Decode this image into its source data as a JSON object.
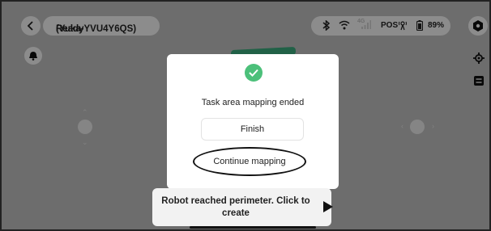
{
  "header": {
    "status_title": "Ready",
    "device_name": "(Yuka-YVU4Y6QS)"
  },
  "status_bar": {
    "bluetooth_icon": "bluetooth-icon",
    "wifi_icon": "wifi-icon",
    "cellular_label": "4G",
    "pos_label": "POS",
    "battery_icon": "battery-icon",
    "battery_percent": "89%"
  },
  "dialog": {
    "message": "Task area mapping ended",
    "finish_label": "Finish",
    "continue_label": "Continue mapping"
  },
  "toast": {
    "text": "Robot reached perimeter. Click to create"
  },
  "colors": {
    "accent_green": "#4cc07a",
    "path_green": "#3aa87a"
  }
}
